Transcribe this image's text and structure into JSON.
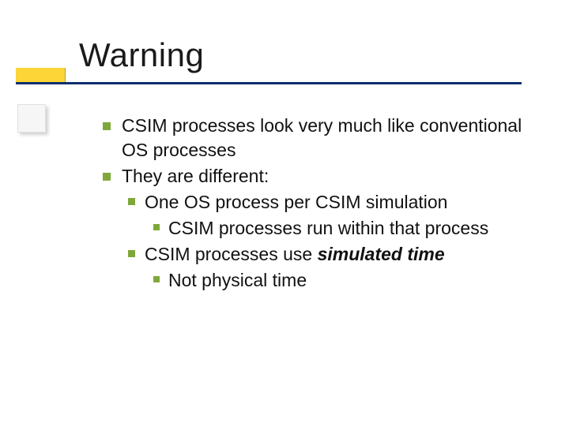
{
  "title": "Warning",
  "bullets": {
    "b1": "CSIM processes look very much like conventional OS processes",
    "b2": "They are different:",
    "b2_1": "One OS process per CSIM simulation",
    "b2_1_1": "CSIM processes run within that process",
    "b2_2_pre": "CSIM processes use ",
    "b2_2_em": "simulated time",
    "b2_2_1": "Not physical time"
  }
}
